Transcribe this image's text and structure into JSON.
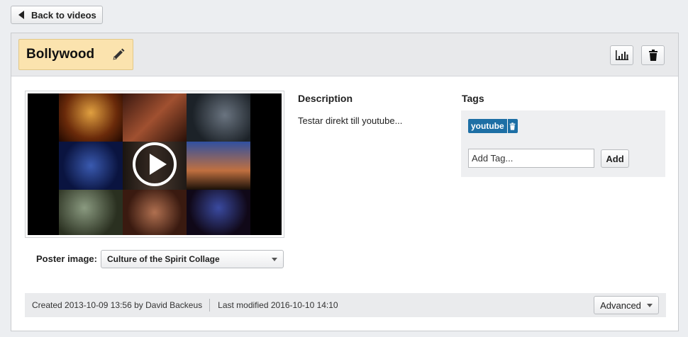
{
  "nav": {
    "back_label": "Back to videos"
  },
  "video": {
    "title": "Bollywood",
    "poster_label": "Poster image:",
    "poster_selected": "Culture of the Spirit Collage"
  },
  "description": {
    "heading": "Description",
    "text": "Testar direkt till youtube..."
  },
  "tags": {
    "heading": "Tags",
    "items": [
      {
        "label": "youtube"
      }
    ],
    "add_placeholder": "Add Tag...",
    "add_label": "Add"
  },
  "footer": {
    "created": "Created 2013-10-09 13:56 by David Backeus",
    "modified": "Last modified 2016-10-10 14:10",
    "advanced_label": "Advanced"
  },
  "icons": {
    "back": "triangle-left-icon",
    "edit": "pencil-icon",
    "stats": "bar-chart-icon",
    "delete": "trash-icon",
    "play": "play-icon",
    "dropdown": "chevron-down-icon"
  },
  "colors": {
    "title_bg": "#fbe3ae",
    "tag_bg": "#1d6fa5",
    "page_bg": "#eceef1"
  }
}
